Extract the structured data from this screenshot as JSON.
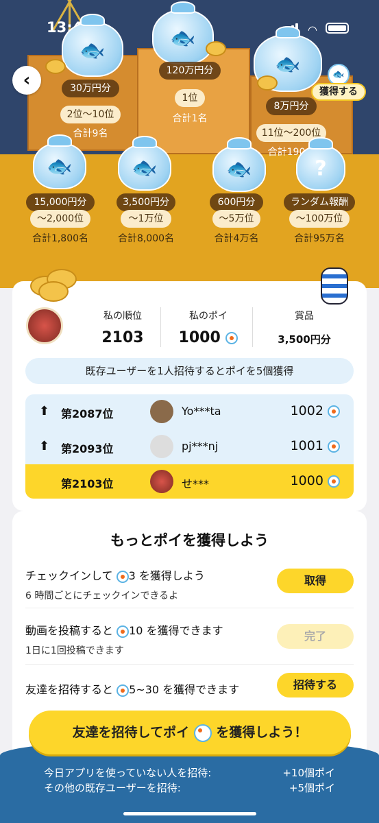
{
  "status_bar": {
    "time": "13:46"
  },
  "prizes": {
    "p1": {
      "amount": "120万円分",
      "range": "1位",
      "total": "合計1名"
    },
    "p2": {
      "amount": "30万円分",
      "range": "2位～10位",
      "total": "合計9名"
    },
    "p3": {
      "amount": "8万円分",
      "range": "11位～200位",
      "total": "合計190名"
    },
    "p4": {
      "amount": "15,000円分",
      "range": "～2,000位",
      "total": "合計1,800名"
    },
    "p5": {
      "amount": "3,500円分",
      "range": "～1万位",
      "total": "合計8,000名"
    },
    "p6": {
      "amount": "600円分",
      "range": "～5万位",
      "total": "合計4万名"
    },
    "p7": {
      "amount": "ランダム報酬",
      "range": "～100万位",
      "total": "合計95万名"
    }
  },
  "get_badge": "獲得する",
  "my_stats": {
    "rank_label": "私の順位",
    "rank_value": "2103",
    "poi_label": "私のポイ",
    "poi_value": "1000",
    "prize_label": "賞品",
    "prize_value": "3,500円分"
  },
  "invite_tip": "既存ユーザーを1人招待するとポイを5個獲得",
  "ranking": [
    {
      "arrow": "⬆",
      "position": "第2087位",
      "name": "Yo***ta",
      "points": "1002"
    },
    {
      "arrow": "⬆",
      "position": "第2093位",
      "name": "pj***nj",
      "points": "1001"
    },
    {
      "arrow": "",
      "position": "第2103位",
      "name": "せ***",
      "points": "1000"
    }
  ],
  "more_title": "もっとポイを獲得しよう",
  "tasks": [
    {
      "title_pre": "チェックインして",
      "title_num": "3",
      "title_post": "を獲得しよう",
      "sub": "6 時間ごとにチェックインできるよ",
      "button": "取得"
    },
    {
      "title_pre": "動画を投稿すると",
      "title_num": "10",
      "title_post": "を獲得できます",
      "sub": "1日に1回投稿できます",
      "button": "完了"
    },
    {
      "title_pre": "友達を招待すると",
      "title_num": "5~30",
      "title_post": "を獲得できます",
      "sub": "",
      "button": "招待する"
    }
  ],
  "cta": {
    "pre": "友達を招待してポイ",
    "post": "を獲得しよう！"
  },
  "rewards": [
    {
      "label": "今日アプリを使っていない人を招待:",
      "value": "+10個ポイ"
    },
    {
      "label": "その他の既存ユーザーを招待:",
      "value": "+5個ポイ"
    }
  ],
  "colors": {
    "accent_yellow": "#fdd62a",
    "banner_orange": "#e6a923",
    "bottom_blue": "#2a6ca3"
  }
}
